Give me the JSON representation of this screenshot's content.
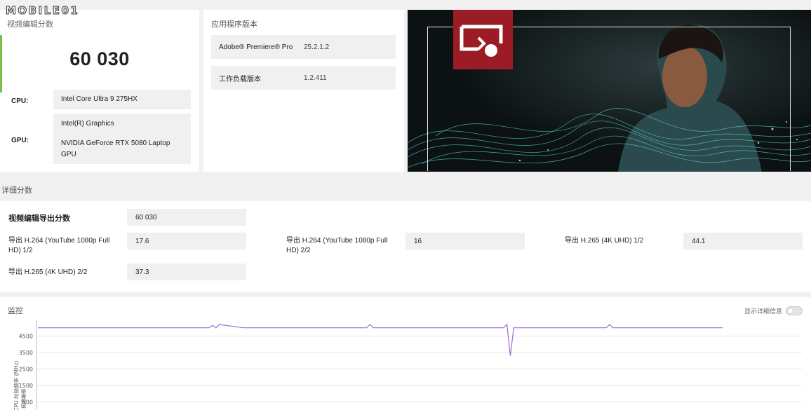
{
  "watermark": {
    "text": "MOBILE01"
  },
  "score_card": {
    "title": "视频编辑分数",
    "score": "60 030",
    "cpu_label": "CPU:",
    "cpu_value": "Intel Core Ultra 9 275HX",
    "gpu_label": "GPU:",
    "gpu_value_1": "Intel(R) Graphics",
    "gpu_value_2a": "NVIDIA GeForce RTX 5080 Laptop",
    "gpu_value_2b": "GPU",
    "accent_color": "#7ac143"
  },
  "version_card": {
    "title": "应用程序版本",
    "rows": [
      {
        "key": "Adobe® Premiere® Pro",
        "value": "25.2.1.2"
      },
      {
        "key": "工作负载版本",
        "value": "1.2.411"
      }
    ]
  },
  "hero": {
    "logo_icon": "presentation-icon",
    "logo_color": "#9b1c24"
  },
  "detail": {
    "title": "详细分数",
    "overall_label": "视频编辑导出分数",
    "overall_value": "60 030",
    "items": [
      {
        "label_1": "导出 H.264 (YouTube 1080p Full",
        "label_2": "HD) 1/2",
        "value": "17.6"
      },
      {
        "label_1": "导出 H.264 (YouTube 1080p Full",
        "label_2": "HD) 2/2",
        "value": "16"
      },
      {
        "label_1": "导出 H.265 (4K UHD) 1/2",
        "label_2": "",
        "value": "44.1"
      },
      {
        "label_1": "导出 H.265 (4K UHD) 2/2",
        "label_2": "",
        "value": "37.3"
      }
    ]
  },
  "monitor": {
    "title": "监控",
    "toggle_label": "显示详细信息",
    "toggle_state": "off"
  },
  "chart_data": {
    "type": "line",
    "ylabel": "CPU 时钟频率 (MHz)",
    "xlabel_fragment": "视频编辑",
    "yticks": [
      500,
      1500,
      2500,
      3500,
      4500
    ],
    "ylim": [
      0,
      5500
    ],
    "series": [
      {
        "color": "#9b6bd6",
        "x": [
          0,
          0.25,
          0.255,
          0.26,
          0.265,
          0.3,
          0.48,
          0.485,
          0.49,
          0.6,
          0.68,
          0.685,
          0.69,
          0.695,
          0.7,
          0.83,
          0.835,
          0.84,
          1.0
        ],
        "values": [
          5000,
          5000,
          5150,
          5000,
          5200,
          5000,
          5000,
          5200,
          5000,
          5000,
          5000,
          5200,
          3300,
          5000,
          5000,
          5000,
          5200,
          5000,
          5000
        ]
      }
    ],
    "grid": true
  }
}
